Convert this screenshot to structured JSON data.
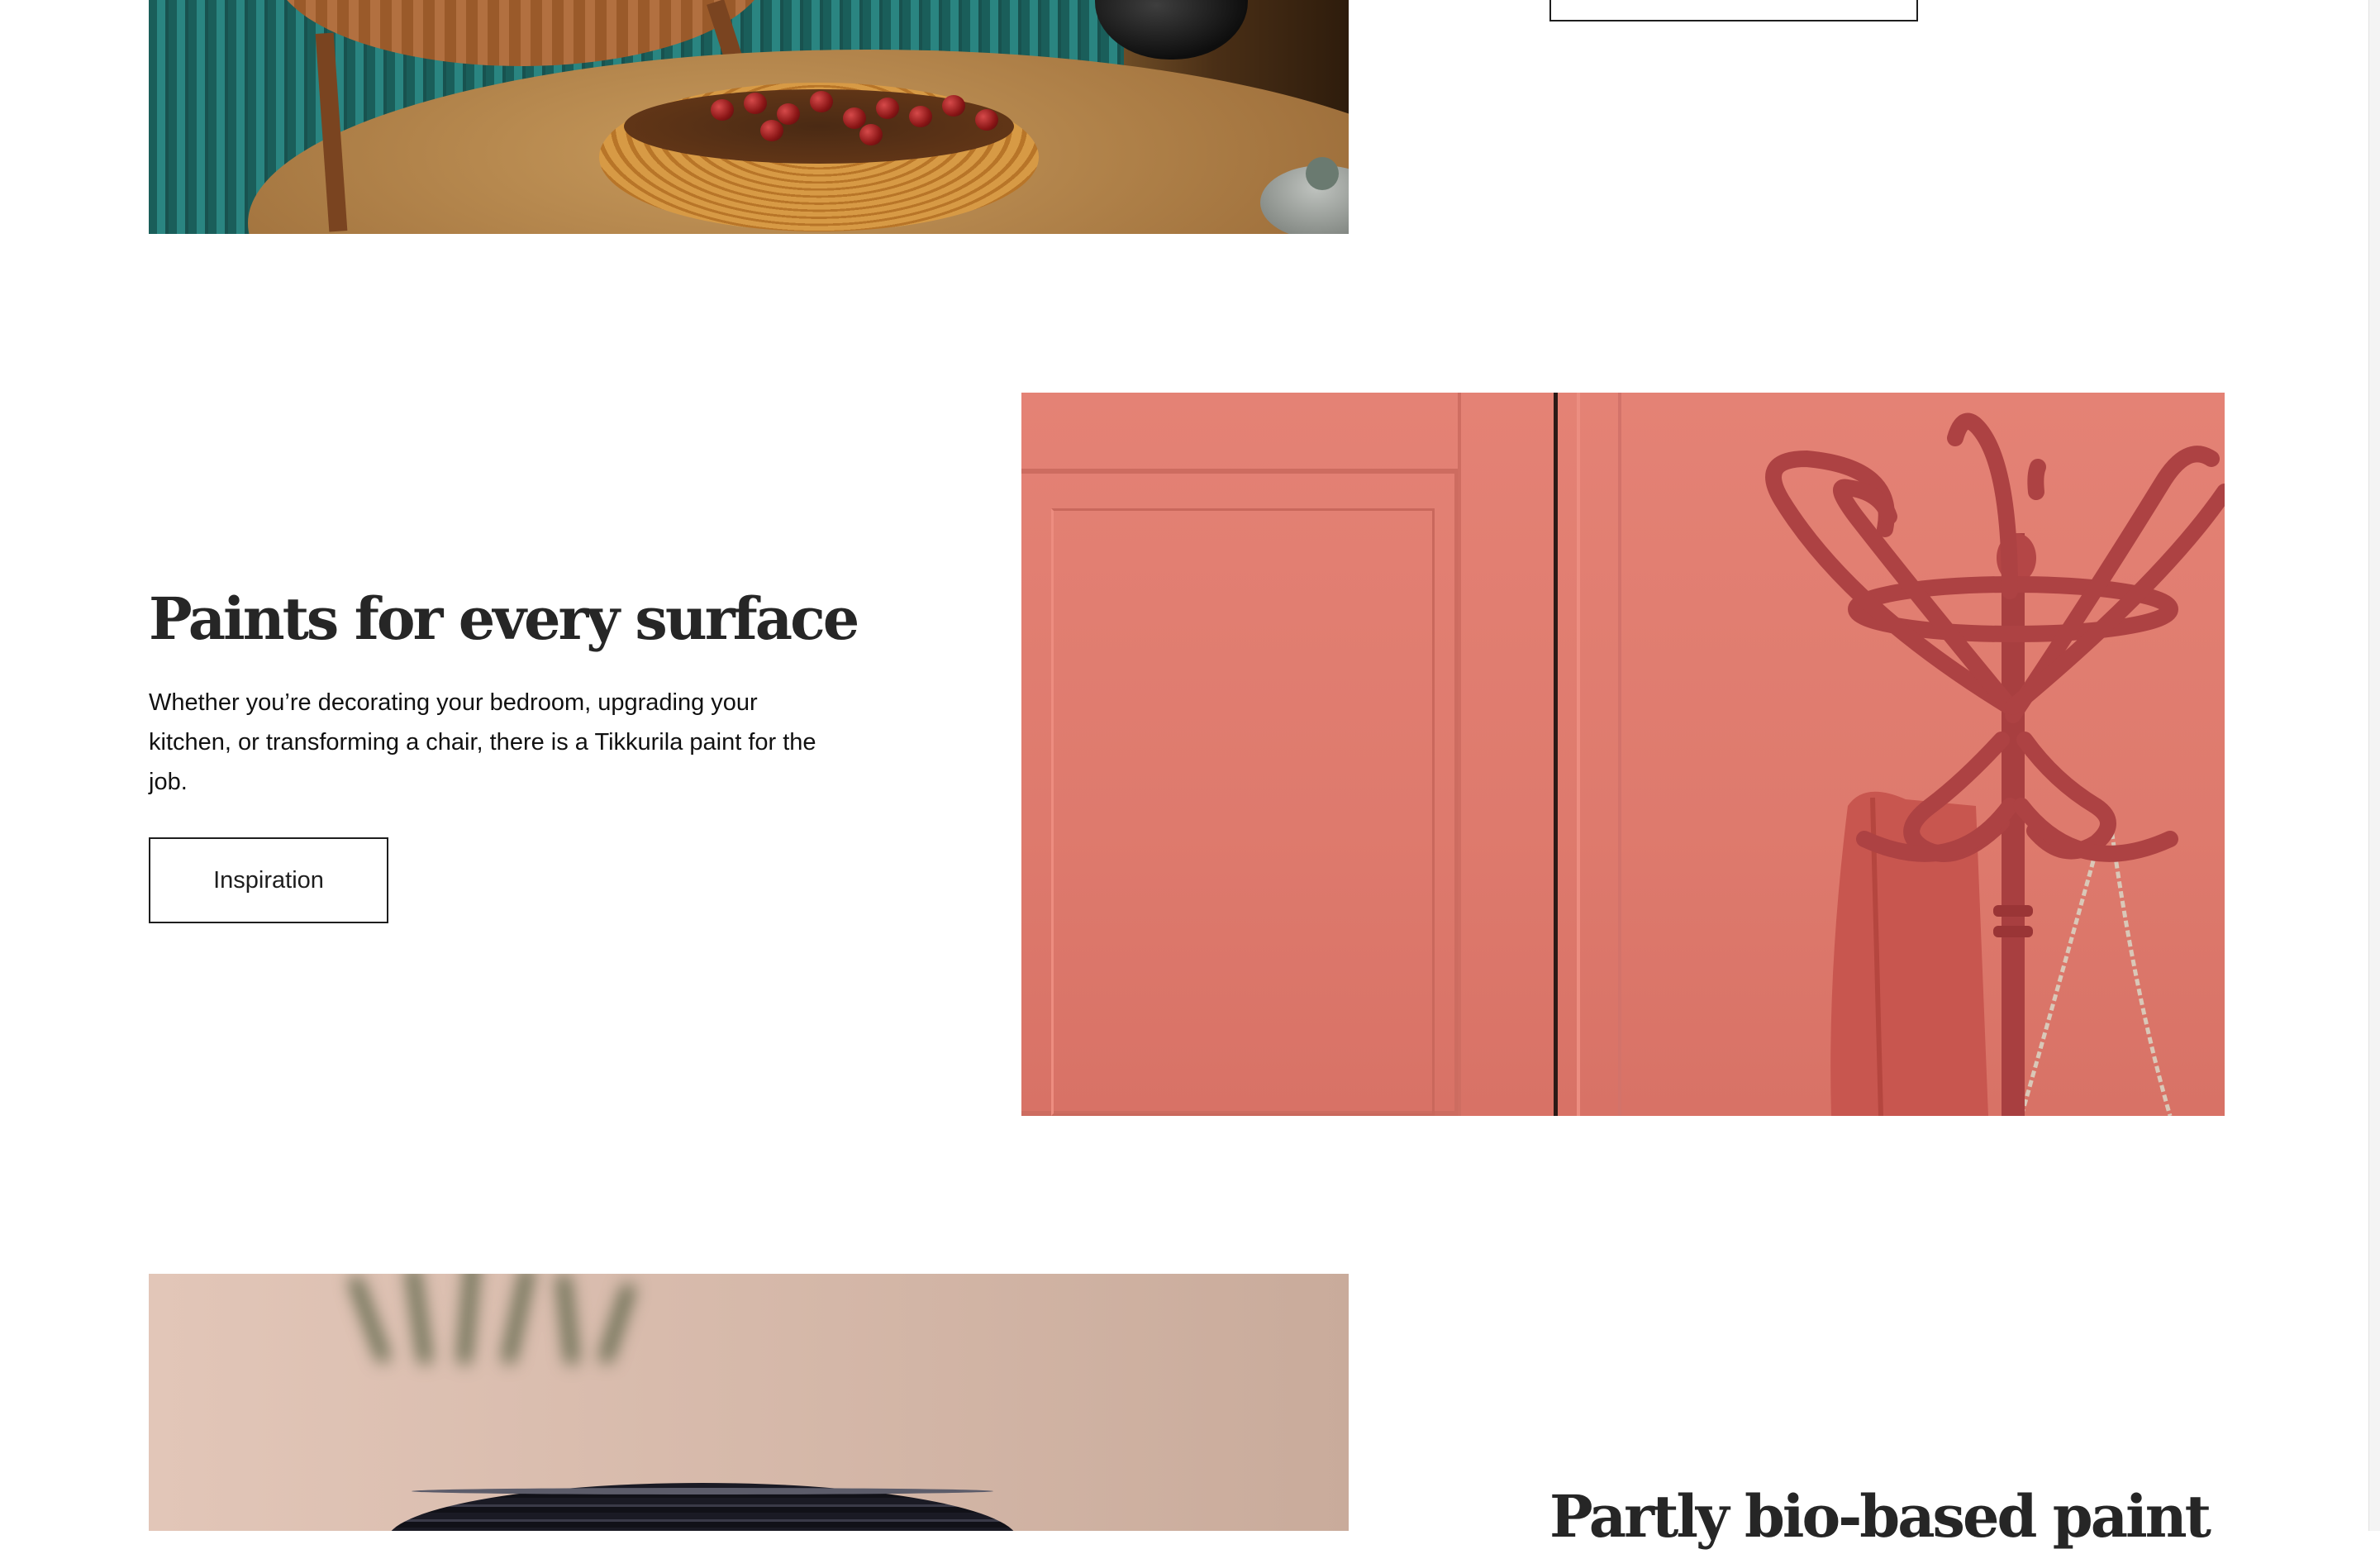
{
  "sections": [
    {
      "title": "",
      "image": {
        "icon": "dining-table-photo"
      },
      "button_label": ""
    },
    {
      "title": "Paints for every surface",
      "body": "Whether you’re decorating your bedroom, upgrading your kitchen, or transforming a chair, there is a Tikkurila paint for the job.",
      "button_label": "Inspiration",
      "image": {
        "icon": "coat-rack-photo"
      }
    },
    {
      "title": "Partly bio-based paint",
      "image": {
        "icon": "black-vase-photo"
      }
    }
  ],
  "colors": {
    "text": "#1e1e1e",
    "heading": "#262626",
    "background": "#ffffff",
    "button_border": "#1e1e1e",
    "accent_pink": "#e07c6f"
  }
}
